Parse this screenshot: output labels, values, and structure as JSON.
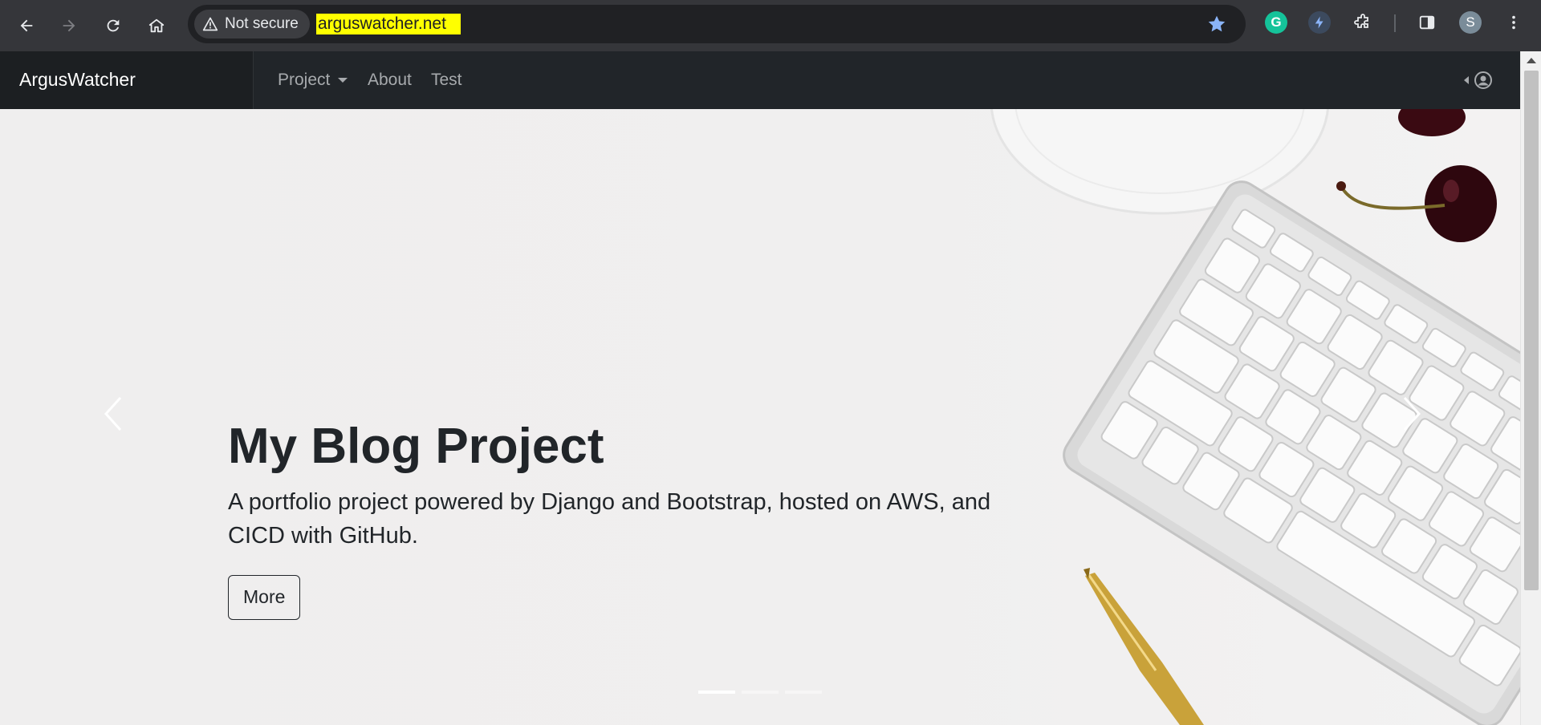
{
  "browser": {
    "security_label": "Not secure",
    "url": "arguswatcher.net",
    "profile_initial": "S",
    "extensions": [
      "grammarly-icon",
      "lightning-extension-icon",
      "puzzle-icon"
    ],
    "colors": {
      "toolbar": "#35363a",
      "omnibox": "#202124",
      "highlight": "#ffff00",
      "star": "#8ab4f8"
    }
  },
  "site": {
    "brand": "ArgusWatcher",
    "nav": {
      "project": "Project",
      "about": "About",
      "test": "Test"
    },
    "colors": {
      "navbar": "#212529",
      "nav_link": "#a7aaad"
    }
  },
  "hero": {
    "title": "My Blog Project",
    "text": "A portfolio project powered by Django and Bootstrap, hosted on AWS, and CICD with GitHub.",
    "button": "More",
    "slides": 3,
    "active_slide": 1
  }
}
